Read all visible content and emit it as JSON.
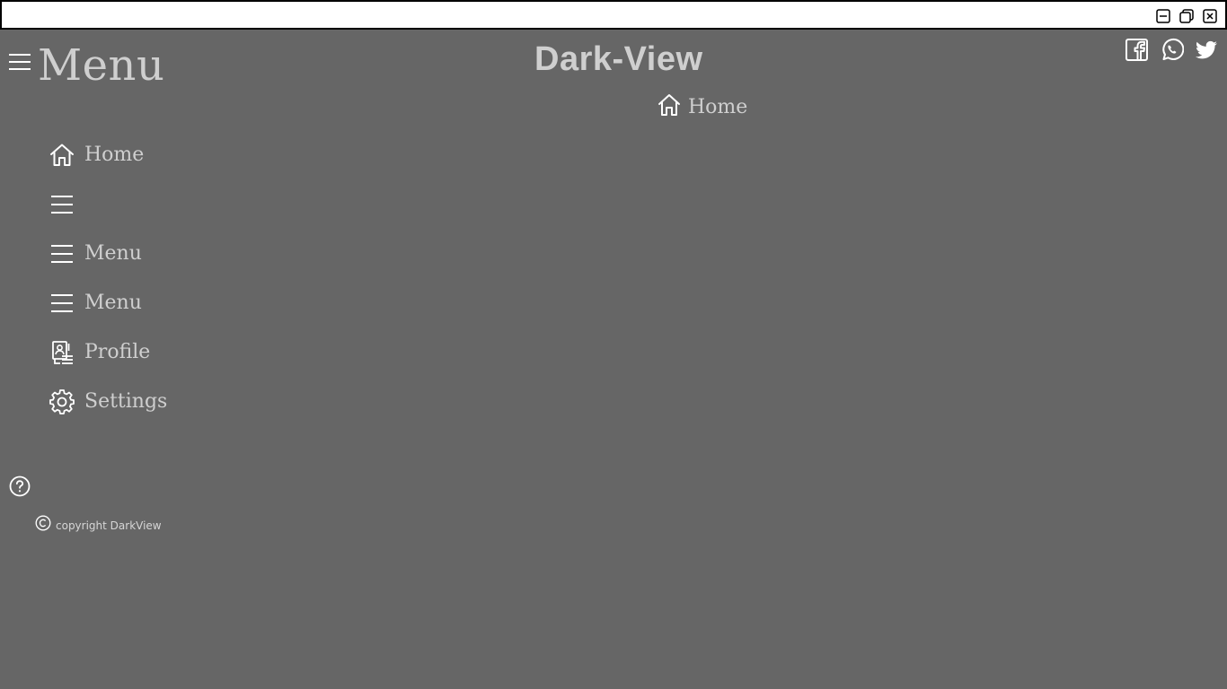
{
  "window": {
    "controls": [
      "minimize-icon",
      "restore-icon",
      "close-icon"
    ]
  },
  "header": {
    "menu_title": "Menu",
    "app_title": "Dark-View",
    "breadcrumb": {
      "icon": "home-icon",
      "label": "Home"
    },
    "social": [
      "facebook-icon",
      "whatsapp-icon",
      "twitter-icon"
    ]
  },
  "sidebar": {
    "items": [
      {
        "icon": "home-icon",
        "label": "Home"
      },
      {
        "icon": "hamburger-icon",
        "label": ""
      },
      {
        "icon": "hamburger-icon",
        "label": "Menu"
      },
      {
        "icon": "hamburger-icon",
        "label": "Menu"
      },
      {
        "icon": "profile-icon",
        "label": "Profile"
      },
      {
        "icon": "gear-icon",
        "label": "Settings"
      }
    ]
  },
  "footer": {
    "help_icon": "help-icon",
    "copyright": "copyright DarkView"
  },
  "colors": {
    "background": "#666666",
    "text": "#cfcfcf",
    "icon_stroke": "#ffffff",
    "titlebar": "#ffffff"
  }
}
